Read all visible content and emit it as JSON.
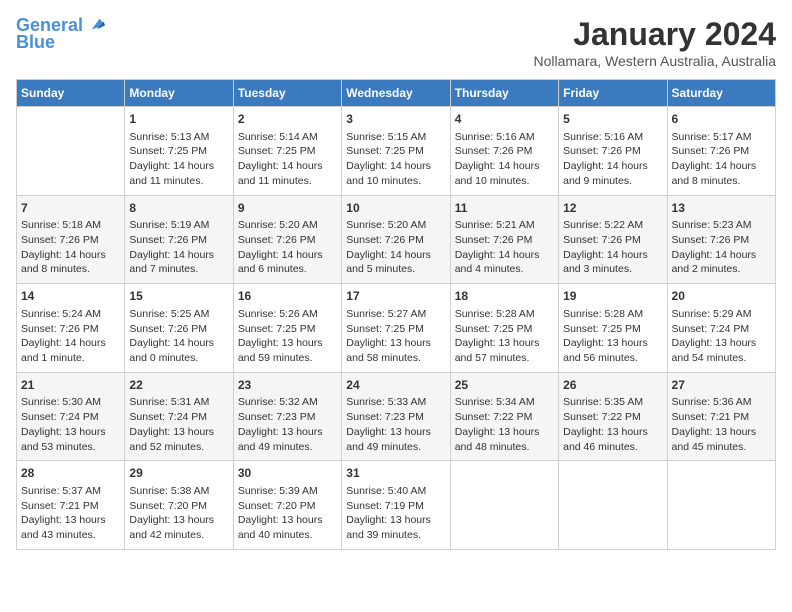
{
  "logo": {
    "line1": "General",
    "line2": "Blue"
  },
  "title": "January 2024",
  "subtitle": "Nollamara, Western Australia, Australia",
  "headers": [
    "Sunday",
    "Monday",
    "Tuesday",
    "Wednesday",
    "Thursday",
    "Friday",
    "Saturday"
  ],
  "rows": [
    [
      {
        "day": "",
        "info": ""
      },
      {
        "day": "1",
        "info": "Sunrise: 5:13 AM\nSunset: 7:25 PM\nDaylight: 14 hours\nand 11 minutes."
      },
      {
        "day": "2",
        "info": "Sunrise: 5:14 AM\nSunset: 7:25 PM\nDaylight: 14 hours\nand 11 minutes."
      },
      {
        "day": "3",
        "info": "Sunrise: 5:15 AM\nSunset: 7:25 PM\nDaylight: 14 hours\nand 10 minutes."
      },
      {
        "day": "4",
        "info": "Sunrise: 5:16 AM\nSunset: 7:26 PM\nDaylight: 14 hours\nand 10 minutes."
      },
      {
        "day": "5",
        "info": "Sunrise: 5:16 AM\nSunset: 7:26 PM\nDaylight: 14 hours\nand 9 minutes."
      },
      {
        "day": "6",
        "info": "Sunrise: 5:17 AM\nSunset: 7:26 PM\nDaylight: 14 hours\nand 8 minutes."
      }
    ],
    [
      {
        "day": "7",
        "info": "Sunrise: 5:18 AM\nSunset: 7:26 PM\nDaylight: 14 hours\nand 8 minutes."
      },
      {
        "day": "8",
        "info": "Sunrise: 5:19 AM\nSunset: 7:26 PM\nDaylight: 14 hours\nand 7 minutes."
      },
      {
        "day": "9",
        "info": "Sunrise: 5:20 AM\nSunset: 7:26 PM\nDaylight: 14 hours\nand 6 minutes."
      },
      {
        "day": "10",
        "info": "Sunrise: 5:20 AM\nSunset: 7:26 PM\nDaylight: 14 hours\nand 5 minutes."
      },
      {
        "day": "11",
        "info": "Sunrise: 5:21 AM\nSunset: 7:26 PM\nDaylight: 14 hours\nand 4 minutes."
      },
      {
        "day": "12",
        "info": "Sunrise: 5:22 AM\nSunset: 7:26 PM\nDaylight: 14 hours\nand 3 minutes."
      },
      {
        "day": "13",
        "info": "Sunrise: 5:23 AM\nSunset: 7:26 PM\nDaylight: 14 hours\nand 2 minutes."
      }
    ],
    [
      {
        "day": "14",
        "info": "Sunrise: 5:24 AM\nSunset: 7:26 PM\nDaylight: 14 hours\nand 1 minute."
      },
      {
        "day": "15",
        "info": "Sunrise: 5:25 AM\nSunset: 7:26 PM\nDaylight: 14 hours\nand 0 minutes."
      },
      {
        "day": "16",
        "info": "Sunrise: 5:26 AM\nSunset: 7:25 PM\nDaylight: 13 hours\nand 59 minutes."
      },
      {
        "day": "17",
        "info": "Sunrise: 5:27 AM\nSunset: 7:25 PM\nDaylight: 13 hours\nand 58 minutes."
      },
      {
        "day": "18",
        "info": "Sunrise: 5:28 AM\nSunset: 7:25 PM\nDaylight: 13 hours\nand 57 minutes."
      },
      {
        "day": "19",
        "info": "Sunrise: 5:28 AM\nSunset: 7:25 PM\nDaylight: 13 hours\nand 56 minutes."
      },
      {
        "day": "20",
        "info": "Sunrise: 5:29 AM\nSunset: 7:24 PM\nDaylight: 13 hours\nand 54 minutes."
      }
    ],
    [
      {
        "day": "21",
        "info": "Sunrise: 5:30 AM\nSunset: 7:24 PM\nDaylight: 13 hours\nand 53 minutes."
      },
      {
        "day": "22",
        "info": "Sunrise: 5:31 AM\nSunset: 7:24 PM\nDaylight: 13 hours\nand 52 minutes."
      },
      {
        "day": "23",
        "info": "Sunrise: 5:32 AM\nSunset: 7:23 PM\nDaylight: 13 hours\nand 49 minutes."
      },
      {
        "day": "24",
        "info": "Sunrise: 5:33 AM\nSunset: 7:23 PM\nDaylight: 13 hours\nand 49 minutes."
      },
      {
        "day": "25",
        "info": "Sunrise: 5:34 AM\nSunset: 7:22 PM\nDaylight: 13 hours\nand 48 minutes."
      },
      {
        "day": "26",
        "info": "Sunrise: 5:35 AM\nSunset: 7:22 PM\nDaylight: 13 hours\nand 46 minutes."
      },
      {
        "day": "27",
        "info": "Sunrise: 5:36 AM\nSunset: 7:21 PM\nDaylight: 13 hours\nand 45 minutes."
      }
    ],
    [
      {
        "day": "28",
        "info": "Sunrise: 5:37 AM\nSunset: 7:21 PM\nDaylight: 13 hours\nand 43 minutes."
      },
      {
        "day": "29",
        "info": "Sunrise: 5:38 AM\nSunset: 7:20 PM\nDaylight: 13 hours\nand 42 minutes."
      },
      {
        "day": "30",
        "info": "Sunrise: 5:39 AM\nSunset: 7:20 PM\nDaylight: 13 hours\nand 40 minutes."
      },
      {
        "day": "31",
        "info": "Sunrise: 5:40 AM\nSunset: 7:19 PM\nDaylight: 13 hours\nand 39 minutes."
      },
      {
        "day": "",
        "info": ""
      },
      {
        "day": "",
        "info": ""
      },
      {
        "day": "",
        "info": ""
      }
    ]
  ]
}
